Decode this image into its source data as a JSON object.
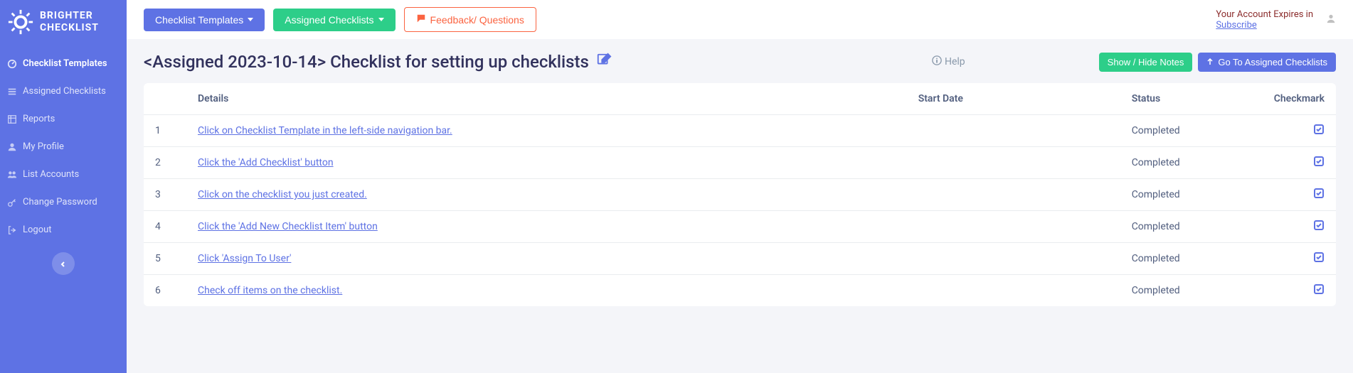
{
  "brand": {
    "line1": "BRIGHTER",
    "line2": "CHECKLIST"
  },
  "sidebar": {
    "items": [
      {
        "label": "Checklist Templates"
      },
      {
        "label": "Assigned Checklists"
      },
      {
        "label": "Reports"
      },
      {
        "label": "My Profile"
      },
      {
        "label": "List Accounts"
      },
      {
        "label": "Change Password"
      },
      {
        "label": "Logout"
      }
    ]
  },
  "topbar": {
    "checklist_templates": "Checklist Templates",
    "assigned_checklists": "Assigned Checklists",
    "feedback": "Feedback/ Questions",
    "account_expires": "Your Account Expires in",
    "subscribe": "Subscribe"
  },
  "page": {
    "title": "<Assigned 2023-10-14> Checklist for setting up checklists",
    "help": "Help",
    "show_hide_notes": "Show / Hide Notes",
    "go_to_assigned": "Go To Assigned Checklists"
  },
  "table": {
    "headers": {
      "details": "Details",
      "start_date": "Start Date",
      "status": "Status",
      "checkmark": "Checkmark"
    },
    "rows": [
      {
        "num": "1",
        "details": "Click on Checklist Template in the left-side navigation bar.",
        "start_date": "",
        "status": "Completed"
      },
      {
        "num": "2",
        "details": "Click the 'Add Checklist' button",
        "start_date": "",
        "status": "Completed"
      },
      {
        "num": "3",
        "details": "Click on the checklist you just created.",
        "start_date": "",
        "status": "Completed"
      },
      {
        "num": "4",
        "details": "Click the 'Add New Checklist Item' button",
        "start_date": "",
        "status": "Completed"
      },
      {
        "num": "5",
        "details": "Click 'Assign To User'",
        "start_date": "",
        "status": "Completed"
      },
      {
        "num": "6",
        "details": "Check off items on the checklist.",
        "start_date": "",
        "status": "Completed"
      }
    ]
  }
}
